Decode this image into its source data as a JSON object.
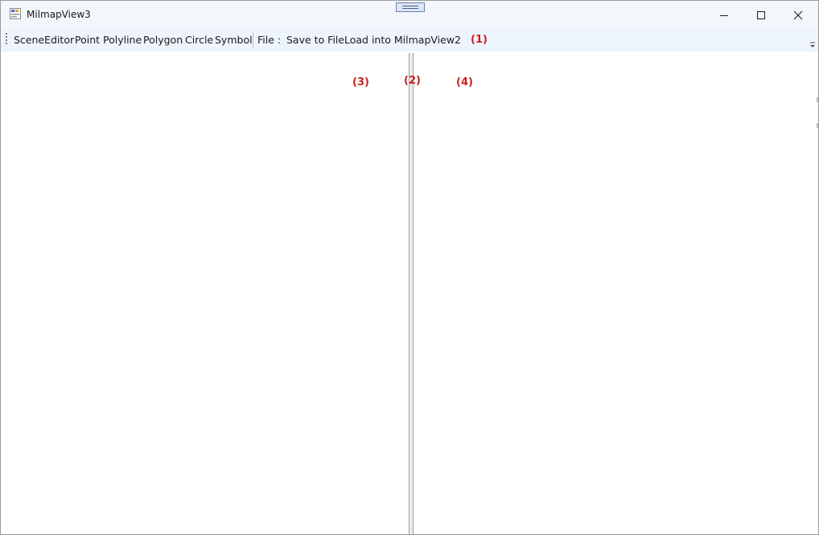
{
  "window": {
    "title": "MilmapView3"
  },
  "toolbar": {
    "items": [
      {
        "label": "SceneEditor"
      },
      {
        "label": "Point"
      },
      {
        "label": "Polyline"
      },
      {
        "label": "Polygon"
      },
      {
        "label": "Circle"
      },
      {
        "label": "Symbol"
      }
    ],
    "file_label": "File :",
    "save_label": "Save to File",
    "load_label": "Load into MilmapView2"
  },
  "annotations": {
    "toolbar": "(1)",
    "splitter": "(2)",
    "left_panel": "(3)",
    "right_panel": "(4)"
  },
  "colors": {
    "titlebar_bg": "#f3f6fb",
    "toolbar_bg": "#eef4fc",
    "annotation_red": "#cc1e1e"
  },
  "icons": {
    "app": "app-window-icon",
    "minimize": "minimize-icon",
    "maximize": "maximize-icon",
    "close": "close-icon",
    "overflow": "toolbar-overflow-icon",
    "grip": "toolbar-grip-icon"
  }
}
